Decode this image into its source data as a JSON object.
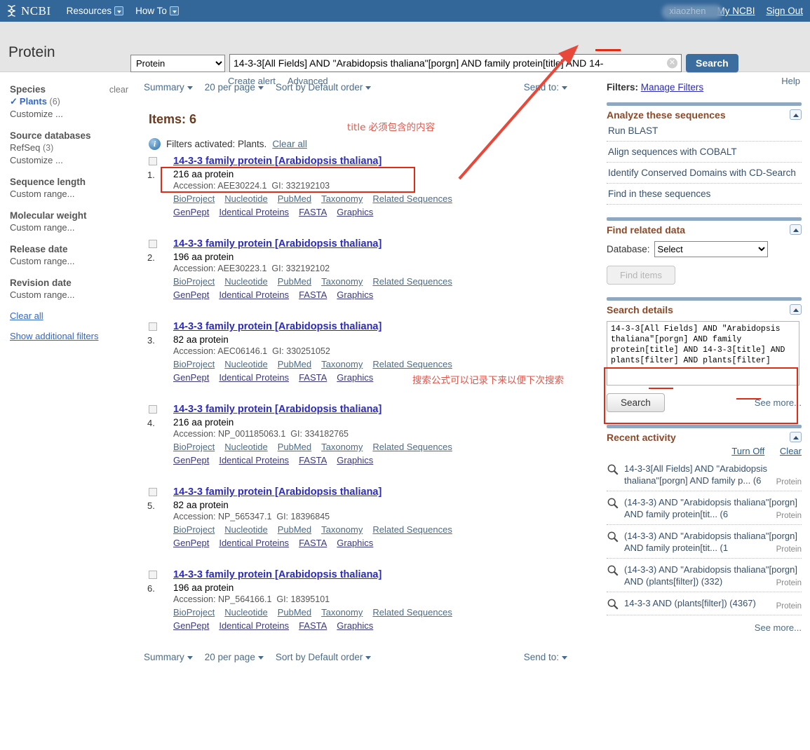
{
  "topbar": {
    "logo_text": "NCBI",
    "menu": [
      {
        "label": "Resources"
      },
      {
        "label": "How To"
      }
    ],
    "username": "xiaozhen",
    "my_ncbi": "My NCBI",
    "sign_out": "Sign Out"
  },
  "search": {
    "db_title": "Protein",
    "db_selected": "Protein",
    "query": "14-3-3[All Fields] AND \"Arabidopsis thaliana\"[porgn] AND family protein[title] AND 14-",
    "search_button": "Search",
    "create_alert": "Create alert",
    "advanced": "Advanced",
    "help": "Help"
  },
  "sidebar": {
    "groups": [
      {
        "title": "Species",
        "clear": "clear",
        "selected": {
          "label": "Plants",
          "count": "(6)"
        },
        "customize": "Customize ..."
      },
      {
        "title": "Source databases",
        "option": {
          "label": "RefSeq",
          "count": "(3)"
        },
        "customize": "Customize ..."
      },
      {
        "title": "Sequence length",
        "customize": "Custom range..."
      },
      {
        "title": "Molecular weight",
        "customize": "Custom range..."
      },
      {
        "title": "Release date",
        "customize": "Custom range..."
      },
      {
        "title": "Revision date",
        "customize": "Custom range..."
      }
    ],
    "clear_all": "Clear all",
    "show_additional": "Show additional filters"
  },
  "toolbar": {
    "display": "Summary",
    "per_page": "20 per page",
    "sort": "Sort by Default order",
    "send_to": "Send to:"
  },
  "results": {
    "items_label": "Items: 6",
    "filters_activated": "Filters activated: Plants.",
    "clear_all": "Clear all",
    "link_row1": [
      "BioProject",
      "Nucleotide",
      "PubMed",
      "Taxonomy",
      "Related Sequences"
    ],
    "link_row2": [
      "GenPept",
      "Identical Proteins",
      "FASTA",
      "Graphics"
    ],
    "accession_label": "Accession:",
    "gi_label": "GI:",
    "list": [
      {
        "num": "1.",
        "title": "14-3-3 family protein [Arabidopsis thaliana]",
        "length": "216 aa protein",
        "accession": "AEE30224.1",
        "gi": "332192103"
      },
      {
        "num": "2.",
        "title": "14-3-3 family protein [Arabidopsis thaliana]",
        "length": "196 aa protein",
        "accession": "AEE30223.1",
        "gi": "332192102"
      },
      {
        "num": "3.",
        "title": "14-3-3 family protein [Arabidopsis thaliana]",
        "length": "82 aa protein",
        "accession": "AEC06146.1",
        "gi": "330251052"
      },
      {
        "num": "4.",
        "title": "14-3-3 family protein [Arabidopsis thaliana]",
        "length": "216 aa protein",
        "accession": "NP_001185063.1",
        "gi": "334182765"
      },
      {
        "num": "5.",
        "title": "14-3-3 family protein [Arabidopsis thaliana]",
        "length": "82 aa protein",
        "accession": "NP_565347.1",
        "gi": "18396845"
      },
      {
        "num": "6.",
        "title": "14-3-3 family protein [Arabidopsis thaliana]",
        "length": "196 aa protein",
        "accession": "NP_564166.1",
        "gi": "18395101"
      }
    ]
  },
  "right": {
    "filters_label": "Filters:",
    "manage_filters": "Manage Filters",
    "analyze": {
      "title": "Analyze these sequences",
      "items": [
        "Run BLAST",
        "Align sequences with COBALT",
        "Identify Conserved Domains with CD-Search",
        "Find in these sequences"
      ]
    },
    "related": {
      "title": "Find related data",
      "database_label": "Database:",
      "database_value": "Select",
      "find_items": "Find items"
    },
    "details": {
      "title": "Search details",
      "query": "14-3-3[All Fields] AND \"Arabidopsis thaliana\"[porgn] AND family protein[title] AND 14-3-3[title] AND plants[filter] AND plants[filter]",
      "search_button": "Search",
      "see_more": "See more..."
    },
    "recent": {
      "title": "Recent activity",
      "turn_off": "Turn Off",
      "clear": "Clear",
      "see_more": "See more...",
      "items": [
        {
          "text": "14-3-3[All Fields] AND \"Arabidopsis thaliana\"[porgn] AND family p... (6",
          "db": "Protein"
        },
        {
          "text": "(14-3-3) AND \"Arabidopsis thaliana\"[porgn] AND family protein[tit... (6",
          "db": "Protein"
        },
        {
          "text": "(14-3-3) AND \"Arabidopsis thaliana\"[porgn] AND family protein[tit... (1",
          "db": "Protein"
        },
        {
          "text": "(14-3-3) AND \"Arabidopsis thaliana\"[porgn] AND (plants[filter]) (332)",
          "db": "Protein"
        },
        {
          "text": "14-3-3 AND (plants[filter]) (4367)",
          "db": "Protein"
        }
      ]
    }
  },
  "annotations": {
    "note_title": "title 必须包含的内容",
    "note_formula": "搜索公式可以记录下来以便下次搜索",
    "accent_red": "#e02b17",
    "accent_text_red": "#e0564b"
  }
}
